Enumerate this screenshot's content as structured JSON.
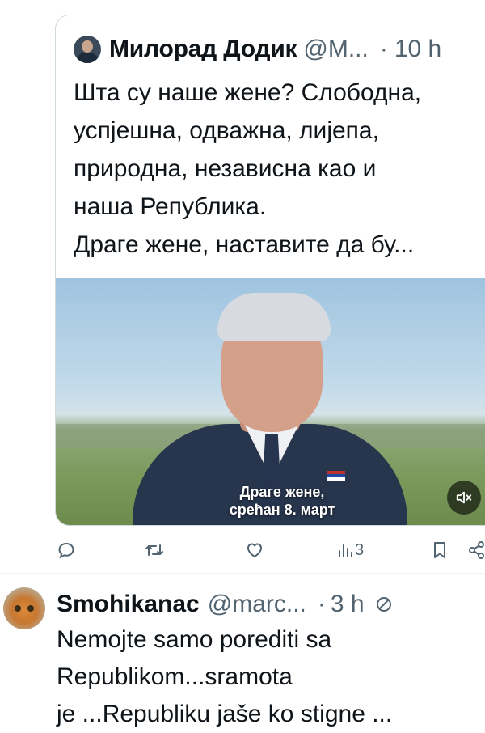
{
  "quoted_tweet": {
    "author_name": "Милорад Додик",
    "handle": "@M...",
    "separator": "·",
    "time": "10 h",
    "text_lines": [
      "Шта су наше жене? Слободна,",
      "успјешна, одважна, лијепа,",
      "природна, независна као и",
      "наша Република.",
      "Драге жене, наставите да бу..."
    ],
    "video": {
      "subtitle_line1": "Драге жене,",
      "subtitle_line2": "срећан 8. март",
      "mute_icon": "speaker-muted-icon"
    }
  },
  "actions": {
    "reply_icon": "reply-icon",
    "retweet_icon": "retweet-icon",
    "like_icon": "heart-icon",
    "views_icon": "views-bar-icon",
    "views_count": "3",
    "bookmark_icon": "bookmark-icon",
    "share_icon": "share-icon"
  },
  "reply_tweet": {
    "author_name": "Smohikanac",
    "handle": "@marc...",
    "separator": "·",
    "time": "3 h",
    "status_icon": "no-entry-icon",
    "text_lines": [
      "Nemojte samo porediti sa",
      "Republikom...sramota",
      "je ...Republiku jaše ko stigne ..."
    ]
  }
}
